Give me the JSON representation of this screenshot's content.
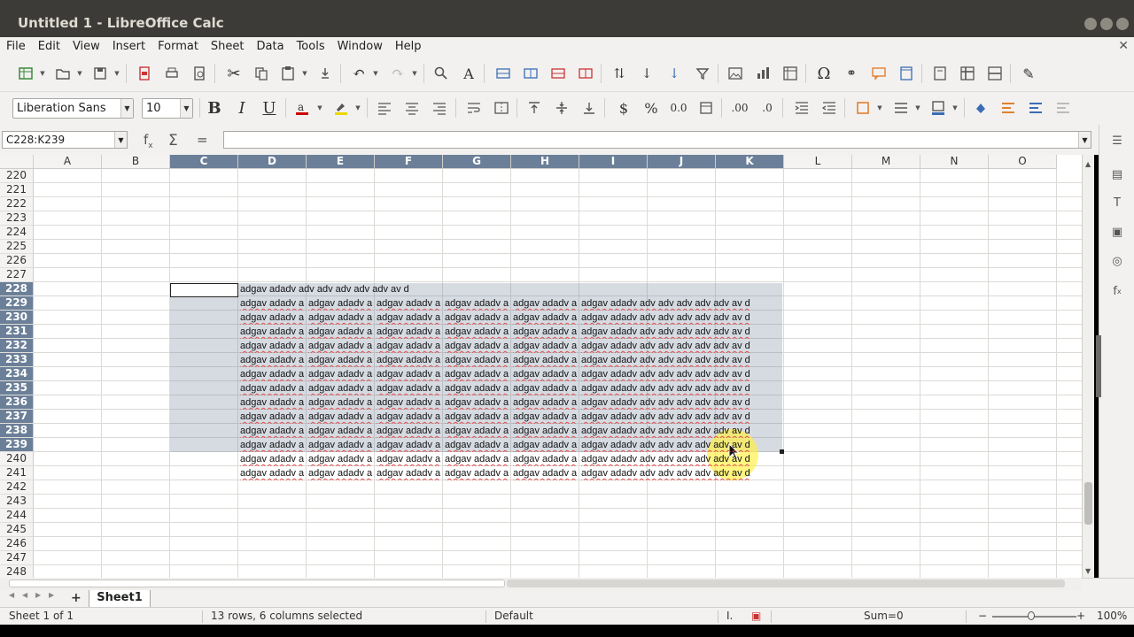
{
  "window": {
    "title": "Untitled 1 - LibreOffice Calc"
  },
  "menu": [
    "File",
    "Edit",
    "View",
    "Insert",
    "Format",
    "Sheet",
    "Data",
    "Tools",
    "Window",
    "Help"
  ],
  "formatting": {
    "font_name": "Liberation Sans",
    "font_size": "10"
  },
  "formula_bar": {
    "name_box": "C228:K239",
    "content": ""
  },
  "columns": [
    "A",
    "B",
    "C",
    "D",
    "E",
    "F",
    "G",
    "H",
    "I",
    "J",
    "K",
    "L",
    "M",
    "N",
    "O"
  ],
  "selected_columns": [
    "C",
    "D",
    "E",
    "F",
    "G",
    "H",
    "I",
    "J",
    "K"
  ],
  "rows": [
    "220",
    "221",
    "222",
    "223",
    "224",
    "225",
    "226",
    "227",
    "228",
    "229",
    "230",
    "231",
    "232",
    "233",
    "234",
    "235",
    "236",
    "237",
    "238",
    "239",
    "240",
    "241",
    "242",
    "243",
    "244",
    "245",
    "246",
    "247",
    "248"
  ],
  "selected_rows": [
    "228",
    "229",
    "230",
    "231",
    "232",
    "233",
    "234",
    "235",
    "236",
    "237",
    "238",
    "239"
  ],
  "cells": {
    "row_228_text": "adgav adadv adv adv adv adv adv av d",
    "full_row_text": "adgav adadv adv adv adv adv adv av d",
    "truncated_text": "adgav adadv a"
  },
  "sheet_tabs": [
    "Sheet1"
  ],
  "status": {
    "sheet": "Sheet 1 of 1",
    "selection": "13 rows, 6 columns selected",
    "page_style": "Default",
    "sum": "Sum=0",
    "zoom": "100%"
  }
}
